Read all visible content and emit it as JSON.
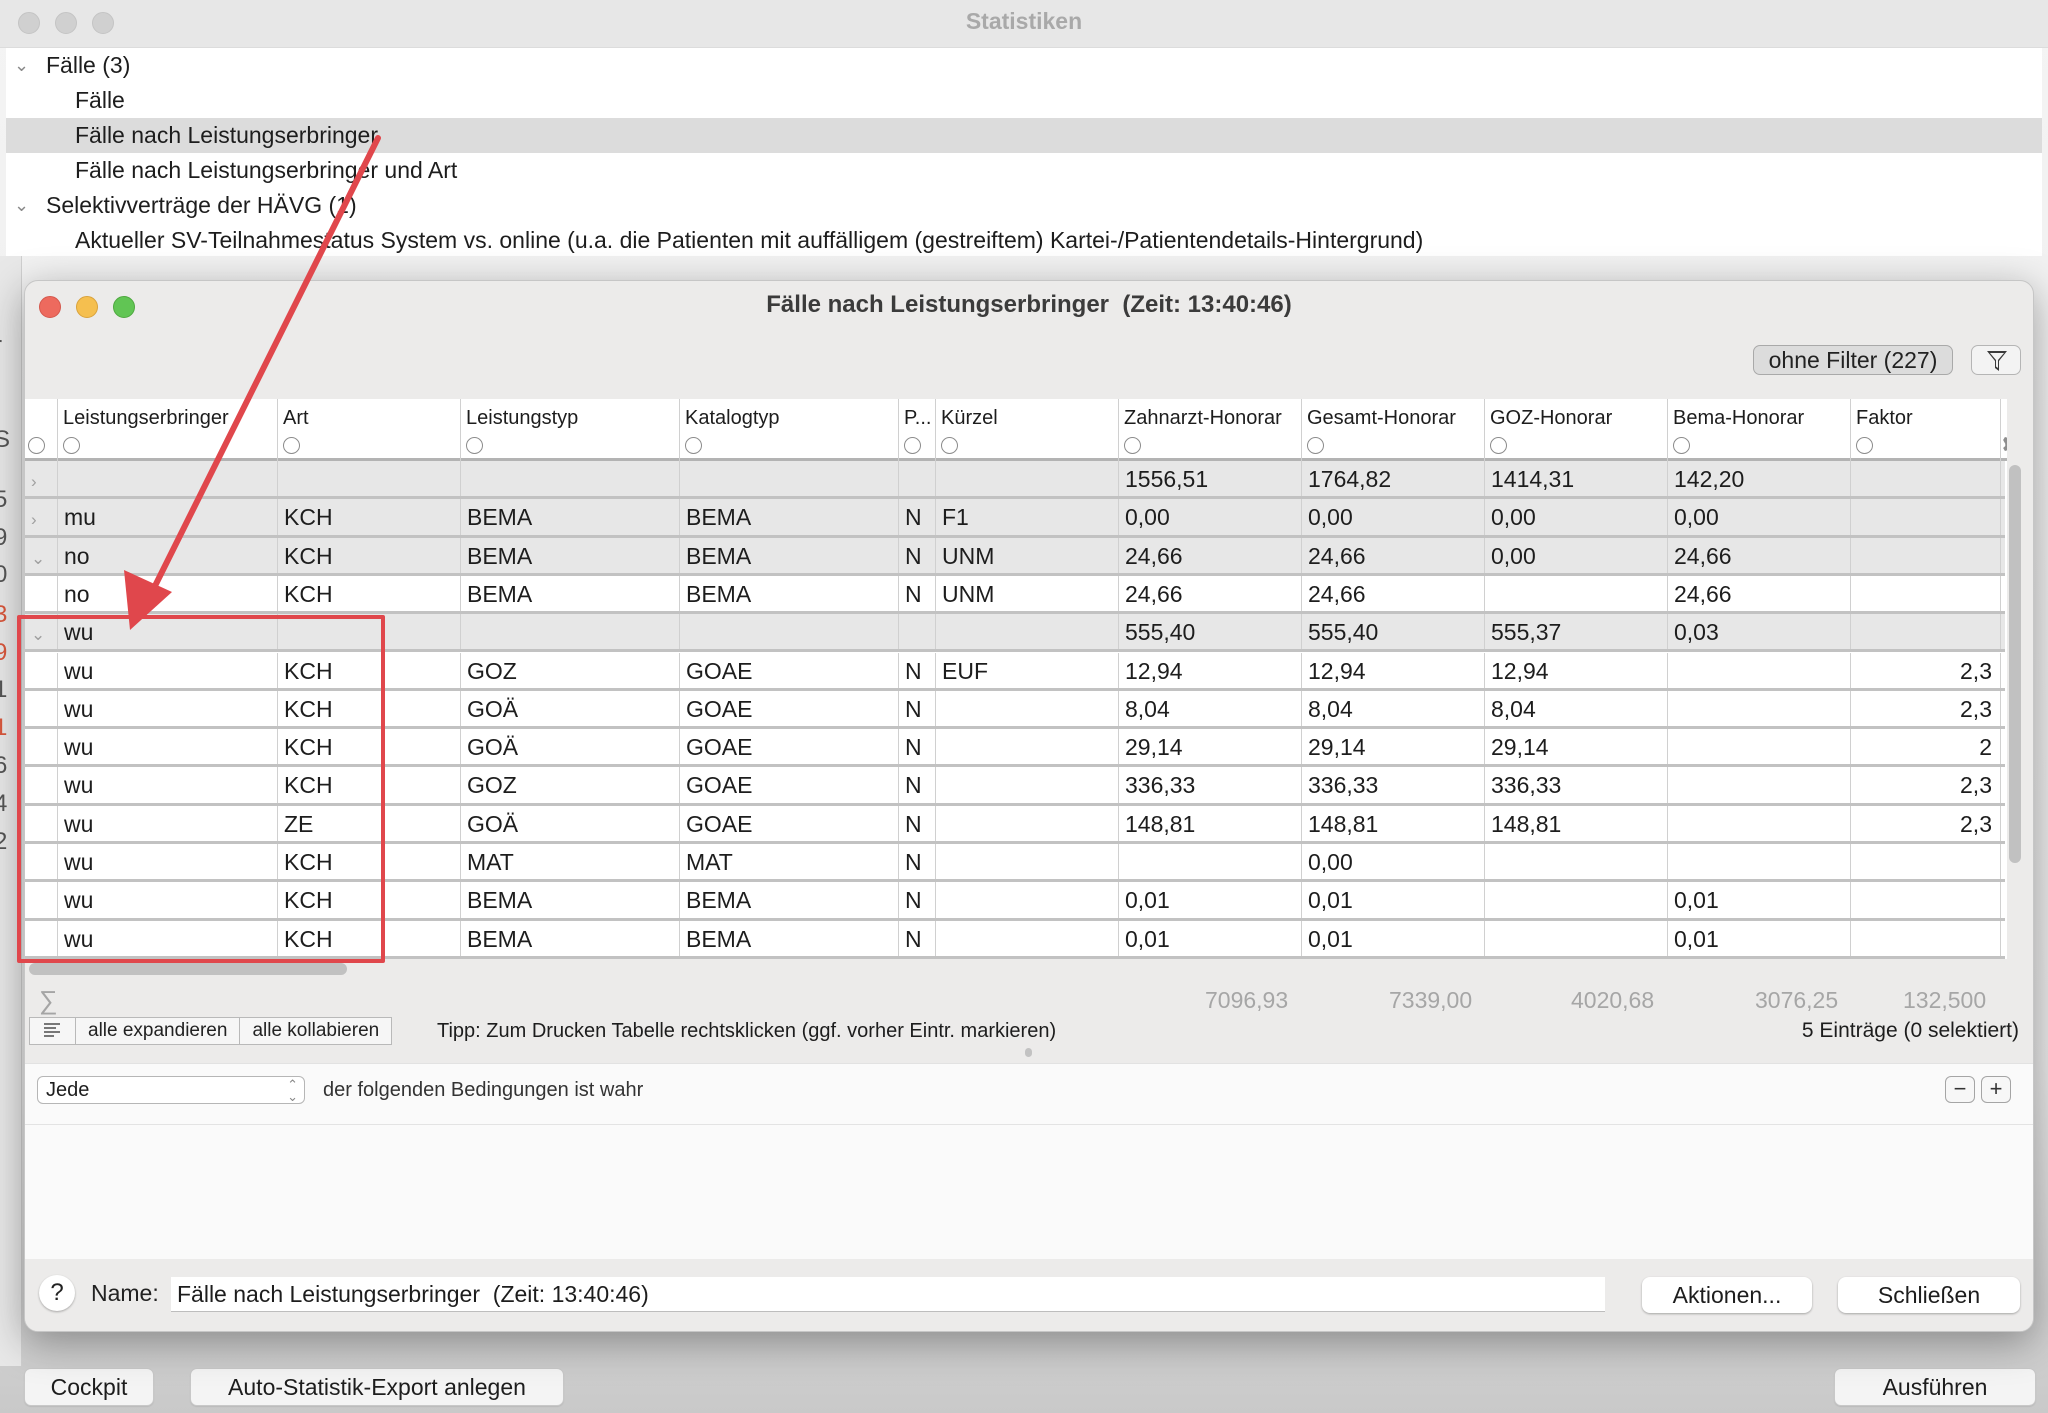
{
  "background_window": {
    "title": "Statistiken",
    "tree": [
      {
        "label": "Fälle (3)",
        "level": 0,
        "expanded": true
      },
      {
        "label": "Fälle",
        "level": 1
      },
      {
        "label": "Fälle nach Leistungserbringer",
        "level": 1,
        "selected": true
      },
      {
        "label": "Fälle nach Leistungserbringer und Art",
        "level": 1
      },
      {
        "label": "Selektivverträge der HÄVG (1)",
        "level": 0,
        "expanded": true
      },
      {
        "label": "Aktueller SV-Teilnahmestatus System vs. online (u.a. die Patienten mit auffälligem (gestreiftem) Kartei-/Patientendetails-Hintergrund)",
        "level": 1
      }
    ],
    "buttons": {
      "cockpit": "Cockpit",
      "auto_export": "Auto-Statistik-Export anlegen",
      "run": "Ausführen"
    }
  },
  "dialog": {
    "title": "Fälle nach Leistungserbringer  (Zeit: 13:40:46)",
    "filter_button": "ohne Filter (227)",
    "columns": [
      "Leistungserbringer",
      "Art",
      "Leistungstyp",
      "Katalogtyp",
      "P...",
      "Kürzel",
      "Zahnarzt-Honorar",
      "Gesamt-Honorar",
      "GOZ-Honorar",
      "Bema-Honorar",
      "Faktor",
      "F"
    ],
    "rows": [
      {
        "type": "group",
        "chevron": "right",
        "cells": [
          "",
          "",
          "",
          "",
          "",
          "",
          "1556,51",
          "1764,82",
          "1414,31",
          "142,20",
          ""
        ]
      },
      {
        "type": "group",
        "chevron": "right",
        "cells": [
          "mu",
          "KCH",
          "BEMA",
          "BEMA",
          "N",
          "F1",
          "0,00",
          "0,00",
          "0,00",
          "0,00",
          ""
        ]
      },
      {
        "type": "group",
        "chevron": "down",
        "cells": [
          "no",
          "KCH",
          "BEMA",
          "BEMA",
          "N",
          "UNM",
          "24,66",
          "24,66",
          "0,00",
          "24,66",
          ""
        ]
      },
      {
        "type": "child",
        "chevron": "",
        "cells": [
          "no",
          "KCH",
          "BEMA",
          "BEMA",
          "N",
          "UNM",
          "24,66",
          "24,66",
          "",
          "24,66",
          ""
        ]
      },
      {
        "type": "group",
        "chevron": "down",
        "cells": [
          "wu",
          "",
          "",
          "",
          "",
          "",
          "555,40",
          "555,40",
          "555,37",
          "0,03",
          ""
        ]
      },
      {
        "type": "child",
        "chevron": "",
        "cells": [
          "wu",
          "KCH",
          "GOZ",
          "GOAE",
          "N",
          "EUF",
          "12,94",
          "12,94",
          "12,94",
          "",
          "2,3"
        ]
      },
      {
        "type": "child",
        "chevron": "",
        "cells": [
          "wu",
          "KCH",
          "GOÄ",
          "GOAE",
          "N",
          "",
          "8,04",
          "8,04",
          "8,04",
          "",
          "2,3"
        ]
      },
      {
        "type": "child",
        "chevron": "",
        "cells": [
          "wu",
          "KCH",
          "GOÄ",
          "GOAE",
          "N",
          "",
          "29,14",
          "29,14",
          "29,14",
          "",
          "2"
        ]
      },
      {
        "type": "child",
        "chevron": "",
        "cells": [
          "wu",
          "KCH",
          "GOZ",
          "GOAE",
          "N",
          "",
          "336,33",
          "336,33",
          "336,33",
          "",
          "2,3"
        ]
      },
      {
        "type": "child",
        "chevron": "",
        "cells": [
          "wu",
          "ZE",
          "GOÄ",
          "GOAE",
          "N",
          "",
          "148,81",
          "148,81",
          "148,81",
          "",
          "2,3"
        ]
      },
      {
        "type": "child",
        "chevron": "",
        "cells": [
          "wu",
          "KCH",
          "MAT",
          "MAT",
          "N",
          "",
          "",
          "0,00",
          "",
          "",
          ""
        ]
      },
      {
        "type": "child",
        "chevron": "",
        "cells": [
          "wu",
          "KCH",
          "BEMA",
          "BEMA",
          "N",
          "",
          "0,01",
          "0,01",
          "",
          "0,01",
          ""
        ]
      },
      {
        "type": "child",
        "chevron": "",
        "cells": [
          "wu",
          "KCH",
          "BEMA",
          "BEMA",
          "N",
          "",
          "0,01",
          "0,01",
          "",
          "0,01",
          ""
        ]
      }
    ],
    "sums": {
      "symbol": "∑",
      "zahnarzt_honorar": "7096,93",
      "gesamt_honorar": "7339,00",
      "goz_honorar": "4020,68",
      "bema_honorar": "3076,25",
      "faktor": "132,500"
    },
    "toolbar": {
      "expand_all": "alle expandieren",
      "collapse_all": "alle kollabieren",
      "tip": "Tipp: Zum Drucken Tabelle rechtsklicken (ggf. vorher Eintr. markieren)",
      "entries": "5 Einträge (0 selektiert)"
    },
    "conditions": {
      "selector_value": "Jede",
      "text": "der folgenden Bedingungen ist wahr",
      "remove_label": "−",
      "add_label": "+"
    },
    "bottom": {
      "help_label": "?",
      "name_label": "Name:",
      "name_value": "Fälle nach Leistungserbringer  (Zeit: 13:40:46)",
      "actions_button": "Aktionen...",
      "close_button": "Schließen"
    }
  },
  "annotation": {
    "color": "#e0474c"
  },
  "icons": {
    "funnel": "filter-funnel-icon",
    "gear": "gear-icon",
    "list": "list-align-icon",
    "sigma": "sigma-icon"
  }
}
